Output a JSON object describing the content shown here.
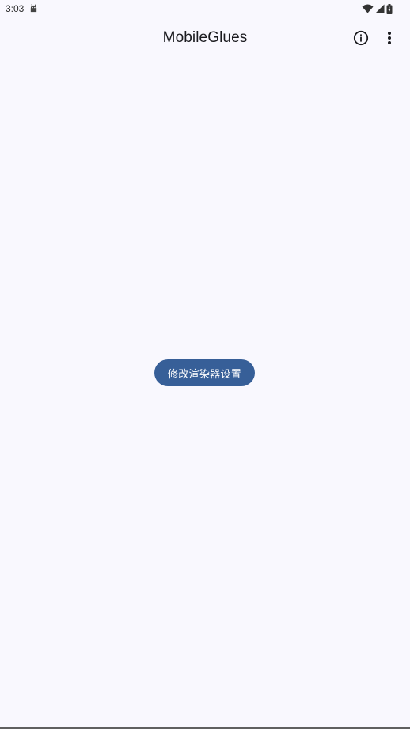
{
  "status_bar": {
    "time": "3:03",
    "notification_icon": "android-icon",
    "wifi_icon": "wifi-icon",
    "signal_icon": "signal-icon",
    "battery_icon": "battery-charging-icon"
  },
  "app_bar": {
    "title": "MobileGlues",
    "info_icon": "info-icon",
    "more_icon": "more-vert-icon"
  },
  "main": {
    "button_label": "修改渲染器设置"
  },
  "colors": {
    "background": "#f9f8fe",
    "button": "#375f98",
    "button_text": "#ffffff",
    "title_text": "#1b1b1f"
  }
}
